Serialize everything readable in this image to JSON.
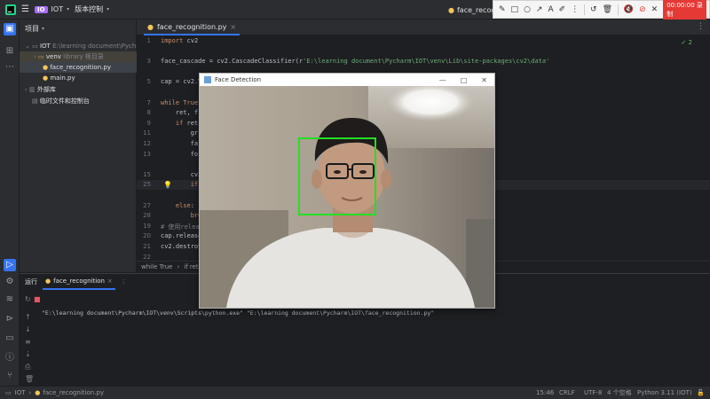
{
  "topbar": {
    "project_badge": "IO",
    "project_name": "IOT",
    "vcs_label": "版本控制",
    "run_config": "face_recognitio"
  },
  "annotation_toolbar": {
    "record_label": "00:00:00 录制"
  },
  "project_panel": {
    "title": "项目",
    "root_name": "IOT",
    "root_path": "E:\\learning document\\Pychar",
    "venv_name": "venv",
    "venv_note": "library 根目录",
    "files": [
      "face_recognition.py",
      "main.py"
    ],
    "external_libs": "外部库",
    "scratches": "临时文件和控制台"
  },
  "editor": {
    "tab_label": "face_recognition.py",
    "check_count": "2",
    "lines": [
      {
        "n": "1",
        "code": [
          [
            "kw",
            "import"
          ],
          [
            "t",
            " cv2"
          ]
        ]
      },
      {
        "n": "",
        "code": []
      },
      {
        "n": "3",
        "code": [
          [
            "t",
            "face_cascade = cv2.CascadeClassifier(r"
          ],
          [
            "str",
            "'E:\\learning document\\Pycharm\\IOT\\venv\\Lib\\site-packages\\cv2\\data'"
          ]
        ]
      },
      {
        "n": "",
        "code": []
      },
      {
        "n": "5",
        "code": [
          [
            "t",
            "cap = cv2.V"
          ]
        ]
      },
      {
        "n": "",
        "code": []
      },
      {
        "n": "7",
        "code": [
          [
            "kw",
            "while"
          ],
          [
            "t",
            " "
          ],
          [
            "kw",
            "True"
          ],
          [
            "t",
            ":"
          ]
        ]
      },
      {
        "n": "8",
        "code": [
          [
            "t",
            "    ret, f"
          ]
        ]
      },
      {
        "n": "9",
        "code": [
          [
            "t",
            "    "
          ],
          [
            "kw",
            "if"
          ],
          [
            "t",
            " ret"
          ]
        ]
      },
      {
        "n": "11",
        "code": [
          [
            "t",
            "        gr"
          ]
        ]
      },
      {
        "n": "12",
        "code": [
          [
            "t",
            "        fa"
          ]
        ]
      },
      {
        "n": "13",
        "code": [
          [
            "t",
            "        fo"
          ]
        ]
      },
      {
        "n": "",
        "code": []
      },
      {
        "n": "15",
        "code": [
          [
            "t",
            "        cv2"
          ]
        ]
      },
      {
        "n": "25",
        "code": [
          [
            "t",
            "        "
          ],
          [
            "kw",
            "if"
          ]
        ]
      },
      {
        "n": "",
        "code": []
      },
      {
        "n": "27",
        "code": [
          [
            "t",
            "    "
          ],
          [
            "kw",
            "else"
          ],
          [
            "t",
            ":"
          ]
        ]
      },
      {
        "n": "28",
        "code": [
          [
            "t",
            "        "
          ],
          [
            "kw",
            "bre"
          ]
        ]
      },
      {
        "n": "19",
        "code": [
          [
            "cm",
            "# 使用relea"
          ]
        ]
      },
      {
        "n": "20",
        "code": [
          [
            "t",
            "cap.release"
          ]
        ]
      },
      {
        "n": "21",
        "code": [
          [
            "t",
            "cv2.destroy"
          ]
        ]
      },
      {
        "n": "22",
        "code": []
      }
    ],
    "breadcrumb": [
      "while True",
      "if ret"
    ]
  },
  "face_window": {
    "title": "Face Detection",
    "detected_faces": 1
  },
  "run_panel": {
    "label": "运行",
    "tab": "face_recognition",
    "output": "\"E:\\learning document\\Pycharm\\IOT\\venv\\Scripts\\python.exe\" \"E:\\learning document\\Pycharm\\IOT\\face_recognition.py\""
  },
  "statusbar": {
    "project": "IOT",
    "file": "face_recognition.py",
    "position": "15:46",
    "line_sep": "CRLF",
    "encoding": "UTF-8",
    "indent": "4 个空格",
    "interpreter": "Python 3.11 (IOT)"
  }
}
